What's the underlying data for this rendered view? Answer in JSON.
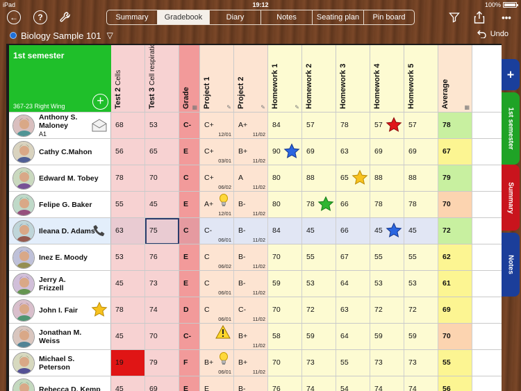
{
  "statusbar": {
    "device": "iPad",
    "time": "19:12",
    "battery": "100%"
  },
  "toolbar": {
    "tabs": [
      {
        "label": "Summary",
        "active": false
      },
      {
        "label": "Gradebook",
        "active": true
      },
      {
        "label": "Diary",
        "active": false
      },
      {
        "label": "Notes",
        "active": false
      },
      {
        "label": "Seating plan",
        "active": false
      },
      {
        "label": "Pin board",
        "active": false
      }
    ],
    "help_glyph": "?",
    "more_glyph": "•••"
  },
  "class": {
    "name": "Biology Sample 101",
    "dropdown_glyph": "▽",
    "color": "#1e6fd8"
  },
  "undo_label": "Undo",
  "corner": {
    "semester": "1st semester",
    "room": "367-23 Right Wing"
  },
  "columns": [
    {
      "title": "Test 2",
      "sub": "Cells",
      "icon": ""
    },
    {
      "title": "Test 3",
      "sub": "Cell respiration",
      "icon": ""
    },
    {
      "title": "Grade",
      "sub": "",
      "icon": "calculator-icon"
    },
    {
      "title": "Project 1",
      "sub": "",
      "icon": "pencil-icon"
    },
    {
      "title": "Project 2",
      "sub": "",
      "icon": "pencil-icon"
    },
    {
      "title": "Homework 1",
      "sub": "",
      "icon": "pencil-icon"
    },
    {
      "title": "Homework 2",
      "sub": "",
      "icon": ""
    },
    {
      "title": "Homework 3",
      "sub": "",
      "icon": ""
    },
    {
      "title": "Homework 4",
      "sub": "",
      "icon": ""
    },
    {
      "title": "Homework 5",
      "sub": "",
      "icon": ""
    },
    {
      "title": "Average",
      "sub": "",
      "icon": "calculator-icon"
    }
  ],
  "students": [
    {
      "name": "Anthony S. Maloney",
      "sub": "A1",
      "icon": "envelope",
      "cells": [
        [
          "68",
          ""
        ],
        [
          "53",
          ""
        ],
        [
          "C-",
          ""
        ],
        [
          "C+",
          "12/01"
        ],
        [
          "A+",
          "11/02"
        ],
        [
          "84",
          ""
        ],
        [
          "57",
          ""
        ],
        [
          "78",
          ""
        ],
        [
          "57",
          ""
        ],
        [
          "57",
          ""
        ],
        [
          "78",
          ""
        ]
      ],
      "marks": [
        [
          8,
          "star-red"
        ]
      ]
    },
    {
      "name": "Cathy C.Mahon",
      "sub": "",
      "icon": "",
      "cells": [
        [
          "56",
          ""
        ],
        [
          "65",
          ""
        ],
        [
          "E",
          ""
        ],
        [
          "C+",
          "03/01"
        ],
        [
          "B+",
          "11/02"
        ],
        [
          "90",
          ""
        ],
        [
          "69",
          ""
        ],
        [
          "63",
          ""
        ],
        [
          "69",
          ""
        ],
        [
          "69",
          ""
        ],
        [
          "67",
          ""
        ]
      ],
      "marks": [
        [
          5,
          "star-blue"
        ]
      ]
    },
    {
      "name": "Edward M. Tobey",
      "sub": "",
      "icon": "",
      "cells": [
        [
          "78",
          ""
        ],
        [
          "70",
          ""
        ],
        [
          "C",
          ""
        ],
        [
          "C+",
          "06/02"
        ],
        [
          "A",
          "11/02"
        ],
        [
          "80",
          ""
        ],
        [
          "88",
          ""
        ],
        [
          "65",
          ""
        ],
        [
          "88",
          ""
        ],
        [
          "88",
          ""
        ],
        [
          "79",
          ""
        ]
      ],
      "marks": [
        [
          7,
          "star-gold"
        ]
      ]
    },
    {
      "name": "Felipe G. Baker",
      "sub": "",
      "icon": "",
      "cells": [
        [
          "55",
          ""
        ],
        [
          "45",
          ""
        ],
        [
          "E",
          ""
        ],
        [
          "A+",
          "12/01"
        ],
        [
          "B-",
          "11/02"
        ],
        [
          "80",
          ""
        ],
        [
          "78",
          ""
        ],
        [
          "66",
          ""
        ],
        [
          "78",
          ""
        ],
        [
          "78",
          ""
        ],
        [
          "70",
          ""
        ]
      ],
      "marks": [
        [
          3,
          "bulb"
        ],
        [
          6,
          "star-green"
        ]
      ]
    },
    {
      "name": "Ileana D. Adams",
      "sub": "",
      "icon": "phone",
      "selected": true,
      "cells": [
        [
          "63",
          ""
        ],
        [
          "75",
          ""
        ],
        [
          "C",
          ""
        ],
        [
          "C-",
          "06/01"
        ],
        [
          "B-",
          "11/02"
        ],
        [
          "84",
          ""
        ],
        [
          "45",
          ""
        ],
        [
          "66",
          ""
        ],
        [
          "45",
          ""
        ],
        [
          "45",
          ""
        ],
        [
          "72",
          ""
        ]
      ],
      "marks": [
        [
          8,
          "star-blue"
        ]
      ]
    },
    {
      "name": "Inez E. Moody",
      "sub": "",
      "icon": "",
      "cells": [
        [
          "53",
          ""
        ],
        [
          "76",
          ""
        ],
        [
          "E",
          ""
        ],
        [
          "C",
          "06/02"
        ],
        [
          "B-",
          "11/02"
        ],
        [
          "70",
          ""
        ],
        [
          "55",
          ""
        ],
        [
          "67",
          ""
        ],
        [
          "55",
          ""
        ],
        [
          "55",
          ""
        ],
        [
          "62",
          ""
        ]
      ],
      "marks": []
    },
    {
      "name": "Jerry A. Frizzell",
      "sub": "",
      "icon": "",
      "cells": [
        [
          "45",
          ""
        ],
        [
          "73",
          ""
        ],
        [
          "E",
          ""
        ],
        [
          "C",
          "06/01"
        ],
        [
          "B-",
          "11/02"
        ],
        [
          "59",
          ""
        ],
        [
          "53",
          ""
        ],
        [
          "64",
          ""
        ],
        [
          "53",
          ""
        ],
        [
          "53",
          ""
        ],
        [
          "61",
          ""
        ]
      ],
      "marks": []
    },
    {
      "name": "John I.  Fair",
      "sub": "",
      "icon": "star",
      "cells": [
        [
          "78",
          ""
        ],
        [
          "74",
          ""
        ],
        [
          "D",
          ""
        ],
        [
          "C",
          "06/01"
        ],
        [
          "C-",
          "11/02"
        ],
        [
          "70",
          ""
        ],
        [
          "72",
          ""
        ],
        [
          "63",
          ""
        ],
        [
          "72",
          ""
        ],
        [
          "72",
          ""
        ],
        [
          "69",
          ""
        ]
      ],
      "marks": []
    },
    {
      "name": "Jonathan M. Weiss",
      "sub": "",
      "icon": "",
      "cells": [
        [
          "45",
          ""
        ],
        [
          "70",
          ""
        ],
        [
          "C-",
          ""
        ],
        [
          "",
          ""
        ],
        [
          "B+",
          "11/02"
        ],
        [
          "58",
          ""
        ],
        [
          "59",
          ""
        ],
        [
          "64",
          ""
        ],
        [
          "59",
          ""
        ],
        [
          "59",
          ""
        ],
        [
          "70",
          ""
        ]
      ],
      "marks": [
        [
          3,
          "warning"
        ]
      ]
    },
    {
      "name": "Michael S. Peterson",
      "sub": "",
      "icon": "",
      "cells": [
        [
          "19",
          ""
        ],
        [
          "79",
          ""
        ],
        [
          "F",
          ""
        ],
        [
          "B+",
          "06/01"
        ],
        [
          "B+",
          "11/02"
        ],
        [
          "70",
          ""
        ],
        [
          "73",
          ""
        ],
        [
          "55",
          ""
        ],
        [
          "73",
          ""
        ],
        [
          "73",
          ""
        ],
        [
          "55",
          ""
        ]
      ],
      "marks": [
        [
          3,
          "bulb"
        ]
      ],
      "alert_col": 0
    },
    {
      "name": "Rebecca D. Kemp",
      "sub": "",
      "icon": "",
      "cells": [
        [
          "45",
          ""
        ],
        [
          "69",
          ""
        ],
        [
          "E",
          ""
        ],
        [
          "E",
          ""
        ],
        [
          "B-",
          ""
        ],
        [
          "76",
          ""
        ],
        [
          "74",
          ""
        ],
        [
          "54",
          ""
        ],
        [
          "74",
          ""
        ],
        [
          "74",
          ""
        ],
        [
          "56",
          ""
        ]
      ],
      "marks": []
    }
  ],
  "selected_cell": {
    "row": 4,
    "col": 1
  },
  "side_tabs": [
    {
      "label": "+",
      "color": "#1a3f9c"
    },
    {
      "label": "1st semester",
      "color": "#1fa326"
    },
    {
      "label": "Summary",
      "color": "#c9141d"
    },
    {
      "label": "Notes",
      "color": "#1b3e9a"
    }
  ],
  "colors": {
    "test_bg": "#f7d2d2",
    "grade_bg": "#f29a9a",
    "project_bg": "#fde4d2",
    "homework_bg": "#fdfbd2",
    "average_bg": "#fde6d0",
    "avg_green": "#c8f0a0",
    "avg_yellow": "#fcf592",
    "avg_orange": "#fcd4b0"
  }
}
